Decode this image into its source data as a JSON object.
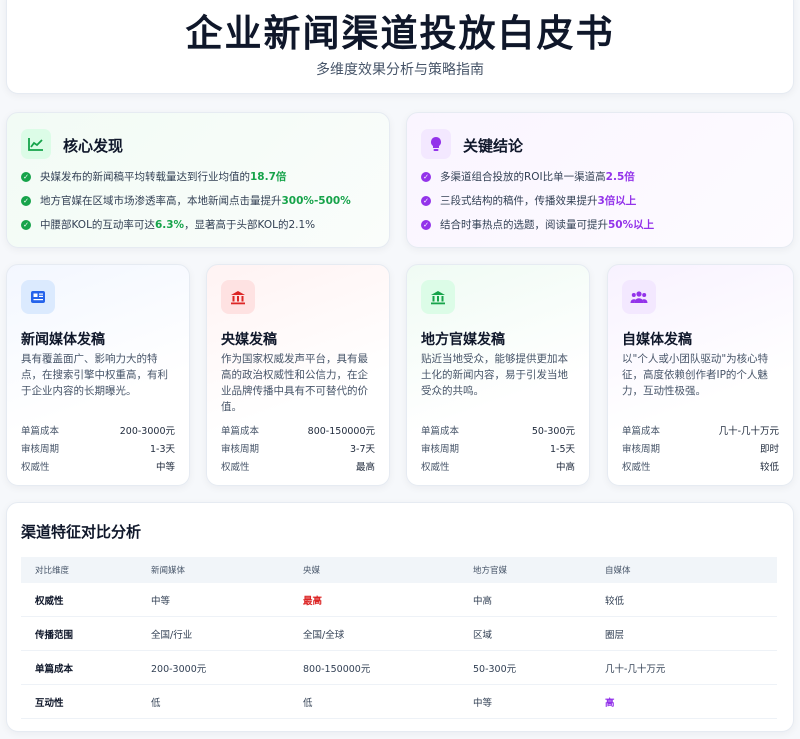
{
  "header": {
    "title": "企业新闻渠道投放白皮书",
    "subtitle": "多维度效果分析与策略指南"
  },
  "findings": [
    {
      "title": "核心发现",
      "icon": "chart-line-icon",
      "accent": "#16a34a",
      "items": [
        {
          "text": "央媒发布的新闻稿平均转载量达到行业均值的",
          "highlight": "18.7倍",
          "tail": ""
        },
        {
          "text": "地方官媒在区域市场渗透率高，本地新闻点击量提升",
          "highlight": "300%-500%",
          "tail": ""
        },
        {
          "text": "中腰部KOL的互动率可达",
          "highlight": "6.3%",
          "tail": "，显著高于头部KOL的2.1%"
        }
      ]
    },
    {
      "title": "关键结论",
      "icon": "lightbulb-icon",
      "accent": "#9333ea",
      "items": [
        {
          "text": "多渠道组合投放的ROI比单一渠道高",
          "highlight": "2.5倍",
          "tail": ""
        },
        {
          "text": "三段式结构的稿件，传播效果提升",
          "highlight": "3倍以上",
          "tail": ""
        },
        {
          "text": "结合时事热点的选题，阅读量可提升",
          "highlight": "50%以上",
          "tail": ""
        }
      ]
    }
  ],
  "channels": [
    {
      "title": "新闻媒体发稿",
      "icon": "newspaper-icon",
      "desc": "具有覆盖面广、影响力大的特点，在搜索引擎中权重高，有利于企业内容的长期曝光。",
      "stats": [
        {
          "label": "单篇成本",
          "value": "200-3000元"
        },
        {
          "label": "审核周期",
          "value": "1-3天"
        },
        {
          "label": "权威性",
          "value": "中等"
        }
      ]
    },
    {
      "title": "央媒发稿",
      "icon": "landmark-icon",
      "desc": "作为国家权威发声平台，具有最高的政治权威性和公信力，在企业品牌传播中具有不可替代的价值。",
      "stats": [
        {
          "label": "单篇成本",
          "value": "800-150000元"
        },
        {
          "label": "审核周期",
          "value": "3-7天"
        },
        {
          "label": "权威性",
          "value": "最高"
        }
      ]
    },
    {
      "title": "地方官媒发稿",
      "icon": "government-building-icon",
      "desc": "贴近当地受众，能够提供更加本土化的新闻内容，易于引发当地受众的共鸣。",
      "stats": [
        {
          "label": "单篇成本",
          "value": "50-300元"
        },
        {
          "label": "审核周期",
          "value": "1-5天"
        },
        {
          "label": "权威性",
          "value": "中高"
        }
      ]
    },
    {
      "title": "自媒体发稿",
      "icon": "users-icon",
      "desc": "以\"个人或小团队驱动\"为核心特征，高度依赖创作者IP的个人魅力，互动性极强。",
      "stats": [
        {
          "label": "单篇成本",
          "value": "几十-几十万元"
        },
        {
          "label": "审核周期",
          "value": "即时"
        },
        {
          "label": "权威性",
          "value": "较低"
        }
      ]
    }
  ],
  "comparison": {
    "title": "渠道特征对比分析",
    "headers": [
      "对比维度",
      "新闻媒体",
      "央媒",
      "地方官媒",
      "自媒体"
    ],
    "rows": [
      {
        "cells": [
          "权威性",
          "中等",
          "最高",
          "中高",
          "较低"
        ],
        "emphasis": {
          "2": "red"
        }
      },
      {
        "cells": [
          "传播范围",
          "全国/行业",
          "全国/全球",
          "区域",
          "圈层"
        ],
        "emphasis": {}
      },
      {
        "cells": [
          "单篇成本",
          "200-3000元",
          "800-150000元",
          "50-300元",
          "几十-几十万元"
        ],
        "emphasis": {}
      },
      {
        "cells": [
          "互动性",
          "低",
          "低",
          "中等",
          "高"
        ],
        "emphasis": {
          "4": "purple"
        }
      }
    ]
  },
  "theme": {
    "green": "#16a34a",
    "purple": "#9333ea",
    "red": "#dc2626",
    "blue": "#2563eb"
  }
}
